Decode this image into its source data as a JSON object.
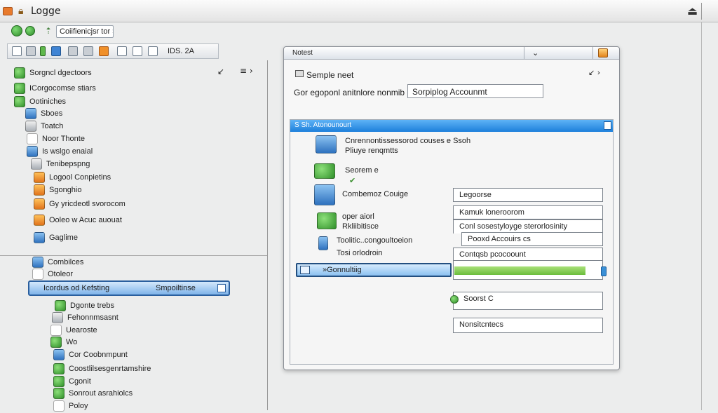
{
  "window": {
    "title": "Logge"
  },
  "address": {
    "text": "Coiifienicjsr tor ›"
  },
  "toolbar": {
    "tools_label": "IDS. 2A"
  },
  "tree": {
    "top_items": [
      {
        "label": "Sorgncl dgectoors",
        "icon": "green"
      },
      {
        "label": "ICorgocomse stiars",
        "icon": "green"
      },
      {
        "label": "Ootiniches",
        "icon": "green"
      },
      {
        "label": "Sboes",
        "icon": "blue"
      },
      {
        "label": "Toatch",
        "icon": "gray"
      },
      {
        "label": "Noor Thonte",
        "icon": "page"
      },
      {
        "label": "Is wslgo enaial",
        "icon": "blue"
      },
      {
        "label": "Tenibepspng",
        "icon": "gray"
      },
      {
        "label": "Logool Conpietins",
        "icon": "orange"
      },
      {
        "label": "Sgonghio",
        "icon": "orange"
      },
      {
        "label": "Gy yricdeotl svorocom",
        "icon": "orange"
      },
      {
        "label": "Ooleo w Acuc auouat",
        "icon": "orange"
      },
      {
        "label": "Gaglime",
        "icon": "blue"
      }
    ],
    "bottom_items": [
      {
        "label": "Combilces",
        "icon": "blue"
      },
      {
        "label": "Otoleor",
        "icon": "page"
      },
      {
        "label": "Dgonte trebs",
        "icon": "green"
      },
      {
        "label": "Fehonnmsasnt",
        "icon": "gray"
      },
      {
        "label": "Uearoste",
        "icon": "page"
      },
      {
        "label": "Wo",
        "icon": "green"
      },
      {
        "label": "Cor Coobnmpunt",
        "icon": "blue"
      },
      {
        "label": "Coostlilsesgenrtamshire",
        "icon": "green"
      },
      {
        "label": "Cgonit",
        "icon": "green"
      },
      {
        "label": "Sonrout asrahiolcs",
        "icon": "green"
      },
      {
        "label": "Poloy",
        "icon": "page"
      }
    ],
    "selected": {
      "left": "Icordus od Kefsting",
      "right": "Smpoiltinse"
    }
  },
  "dialog": {
    "title": "Notest",
    "header": "Semple neet",
    "account_label": "Gor egoponl anitnlore nonmib",
    "account_value": "Sorpiplog Accounmt",
    "section_title": "S Sh. Atonounourt",
    "options": [
      {
        "text": "Cnrennontissessorod couses e Ssoh",
        "sub": "Pliuye renqmtts",
        "icon": "blue"
      },
      {
        "text": "Seorem e",
        "sub": "",
        "icon": "green"
      },
      {
        "text": "Combemoz Couige",
        "sub": "",
        "icon": "blue"
      },
      {
        "text": "oper aiorl",
        "sub": "Rkliibitisce",
        "icon": "green"
      },
      {
        "text": "Toolitic..congoultoeion",
        "sub": "Tosi orlodroin",
        "icon": "blue"
      }
    ],
    "computing_label": "»Gonnultiig",
    "fields": [
      "Legoorse",
      "Kamuk loneroorom",
      "Conl sosestyloyge sterorlosinity",
      "Pooxd Accouirs cs",
      "Contqsb pcocoount",
      "Soorst C",
      "Nonsitcntecs"
    ],
    "progress": 0.88
  }
}
